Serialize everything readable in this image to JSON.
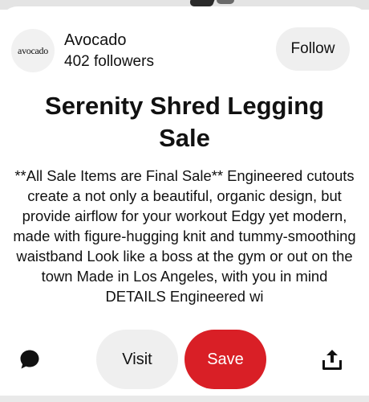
{
  "pin": {
    "creator": {
      "avatar_text": "avocado",
      "name": "Avocado",
      "followers": "402 followers",
      "follow_label": "Follow"
    },
    "title": "Serenity Shred Legging Sale",
    "description": "**All Sale Items are Final Sale** Engineered cutouts create a not only a beautiful, organic design, but provide airflow for your workout Edgy yet modern, made with figure-hugging knit and tummy-smoothing waistband Look like a boss at the gym or out on the town Made in Los Angeles, with you in mind DETAILS Engineered wi"
  },
  "actions": {
    "comment_icon": "comment-bubble-icon",
    "visit_label": "Visit",
    "save_label": "Save",
    "share_icon": "share-upload-icon"
  },
  "colors": {
    "save_red": "#d91f26",
    "button_gray": "#efefef",
    "text": "#111111"
  }
}
